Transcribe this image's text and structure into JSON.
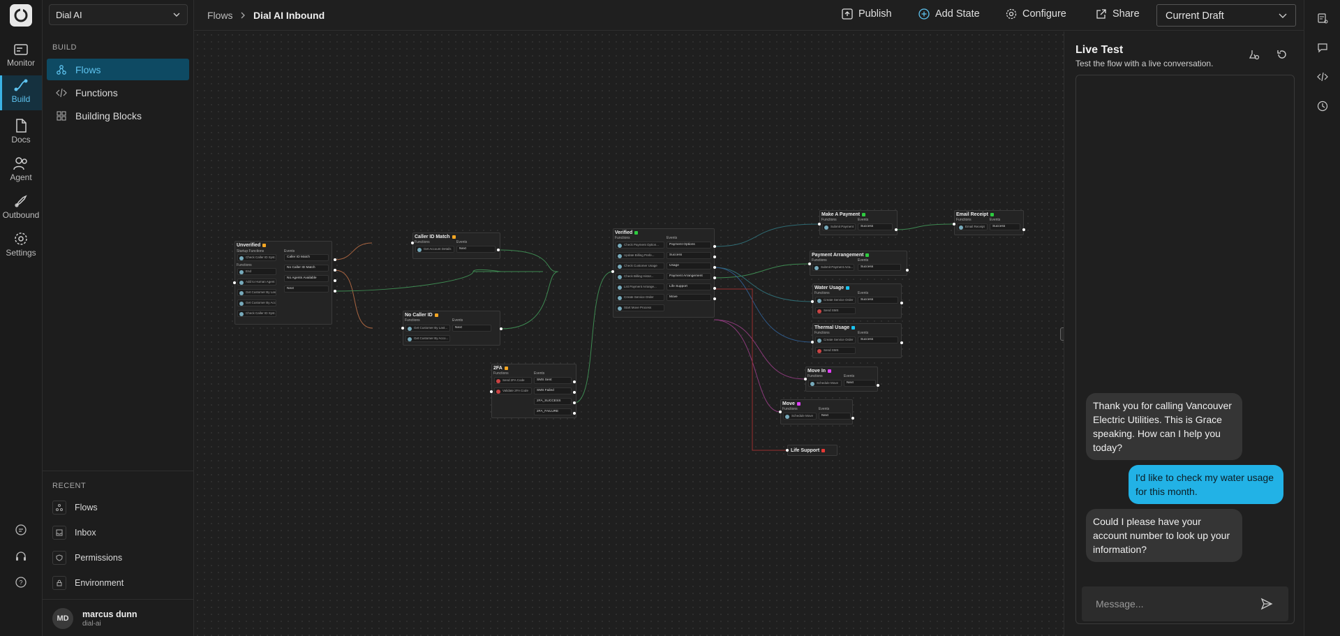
{
  "org": {
    "selected": "Dial AI"
  },
  "rail": {
    "items": [
      {
        "label": "Monitor",
        "icon": "monitor-icon"
      },
      {
        "label": "Build",
        "icon": "build-icon",
        "active": true
      },
      {
        "label": "Docs",
        "icon": "docs-icon"
      },
      {
        "label": "Agent",
        "icon": "agent-icon"
      },
      {
        "label": "Outbound",
        "icon": "outbound-icon"
      },
      {
        "label": "Settings",
        "icon": "settings-icon"
      }
    ]
  },
  "sidebar": {
    "section": "BUILD",
    "items": [
      {
        "label": "Flows",
        "icon": "flows-icon",
        "active": true
      },
      {
        "label": "Functions",
        "icon": "code-icon"
      },
      {
        "label": "Building Blocks",
        "icon": "blocks-icon"
      }
    ],
    "recent_label": "RECENT",
    "recent": [
      {
        "label": "Flows",
        "icon": "flows-icon"
      },
      {
        "label": "Inbox",
        "icon": "inbox-icon"
      },
      {
        "label": "Permissions",
        "icon": "shield-icon"
      },
      {
        "label": "Environment",
        "icon": "lock-icon"
      }
    ]
  },
  "user": {
    "initials": "MD",
    "name": "marcus dunn",
    "org": "dial-ai"
  },
  "breadcrumb": {
    "parent": "Flows",
    "current": "Dial AI Inbound"
  },
  "toolbar": {
    "publish": "Publish",
    "add_state": "Add State",
    "configure": "Configure",
    "share": "Share",
    "draft": "Current Draft"
  },
  "flow": {
    "unverified": {
      "title": "Unverified",
      "sub": "Startup Functions",
      "functions_label": "Functions",
      "events_label": "Events",
      "startup": [
        "Check Caller ID Syst..."
      ],
      "functions": [
        "End",
        "Add to Human Agent Q...",
        "Get Customer By Last...",
        "Get Customer By Acco...",
        "Check Caller ID Syst..."
      ],
      "events": [
        "Caller ID Match",
        "No Caller ID Match",
        "No Agents Available",
        "Next"
      ]
    },
    "caller_id_match": {
      "title": "Caller ID Match",
      "functions_label": "Functions",
      "events_label": "Events",
      "functions": [
        "Get Account Details"
      ],
      "events": [
        "Next"
      ]
    },
    "no_caller_id": {
      "title": "No Caller ID",
      "functions_label": "Functions",
      "events_label": "Events",
      "functions": [
        "Get Customer By Last...",
        "Get Customer By Acco..."
      ],
      "events": [
        "Next"
      ]
    },
    "twofa": {
      "title": "2FA",
      "functions_label": "Functions",
      "events_label": "Events",
      "functions": [
        "Send 2FA Code",
        "Validate 2FA Code"
      ],
      "events": [
        "SMS Sent",
        "SMS Failed",
        "2FA_SUCCESS",
        "2FA_FAILURE"
      ]
    },
    "verified": {
      "title": "Verified",
      "functions_label": "Functions",
      "events_label": "Events",
      "functions": [
        "Check Payment Option...",
        "Update Billing Prefe...",
        "Check Customer Usage",
        "Check Billing Histor...",
        "List Payment Arrange...",
        "Create Service Order",
        "Start Move Process"
      ],
      "events": [
        "Payment Options",
        "Success",
        "Usage",
        "Payment Arrangement",
        "Life Support",
        "Move"
      ]
    },
    "make_payment": {
      "title": "Make A Payment",
      "functions_label": "Functions",
      "events_label": "Events",
      "functions": [
        "Submit Payment"
      ],
      "events": [
        "Success"
      ]
    },
    "email_receipt": {
      "title": "Email Receipt",
      "functions_label": "Functions",
      "events_label": "Events",
      "functions": [
        "Email Receipt"
      ],
      "events": [
        "Success"
      ]
    },
    "payment_arrangement": {
      "title": "Payment Arrangement",
      "functions_label": "Functions",
      "events_label": "Events",
      "functions": [
        "Submit Payment Arra..."
      ],
      "events": [
        "Success"
      ]
    },
    "water_usage": {
      "title": "Water Usage",
      "functions_label": "Functions",
      "events_label": "Events",
      "functions": [
        "Create Service Order",
        "Send SMS"
      ],
      "events": [
        "Success"
      ]
    },
    "thermal_usage": {
      "title": "Thermal Usage",
      "functions_label": "Functions",
      "events_label": "Events",
      "functions": [
        "Create Service Order",
        "Send SMS"
      ],
      "events": [
        "Success"
      ]
    },
    "move_in": {
      "title": "Move In",
      "functions_label": "Functions",
      "events_label": "Events",
      "functions": [
        "Schedule Move"
      ],
      "events": [
        "Next"
      ]
    },
    "move": {
      "title": "Move",
      "functions_label": "Functions",
      "events_label": "Events",
      "functions": [
        "Schedule Move"
      ],
      "events": [
        "Next"
      ]
    },
    "life_support": {
      "title": "Life Support"
    }
  },
  "live_test": {
    "title": "Live Test",
    "subtitle": "Test the flow with a live conversation.",
    "messages": [
      {
        "role": "bot",
        "text": "Thank you for calling Vancouver Electric Utilities. This is Grace speaking. How can I help you today?"
      },
      {
        "role": "user",
        "text": "I'd like to check my water usage for this month."
      },
      {
        "role": "bot",
        "text": "Could I please have your account number to look up your information?"
      }
    ],
    "placeholder": "Message..."
  },
  "colors": {
    "accent": "#22b2e6",
    "active_nav": "#0e4a63",
    "orange": "#f5a623",
    "green": "#2ecc40",
    "cyan": "#19c3f0",
    "magenta": "#e040fb",
    "red": "#e53935"
  }
}
